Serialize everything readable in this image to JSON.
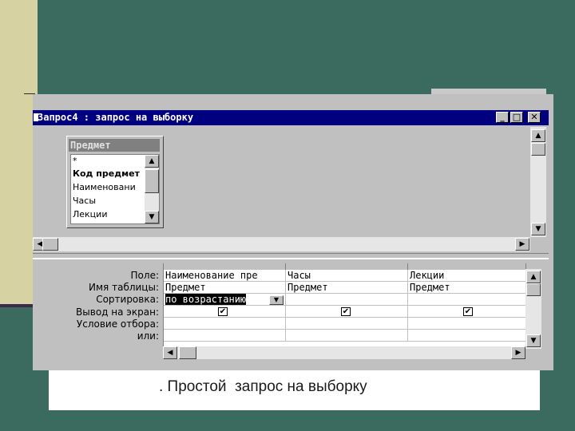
{
  "window": {
    "title": "Запрос4 : запрос на выборку",
    "minimize_glyph": "_",
    "maximize_glyph": "□",
    "close_glyph": "✕"
  },
  "field_list": {
    "title": "Предмет",
    "items": [
      "*",
      "Код предмет",
      "Наименовани",
      "Часы",
      "Лекции"
    ]
  },
  "grid": {
    "row_labels": [
      "Поле:",
      "Имя таблицы:",
      "Сортировка:",
      "Вывод на экран:",
      "Условие отбора:",
      "или:"
    ],
    "columns": [
      {
        "field": "Наименование пре",
        "table": "Предмет",
        "sort": "по возрастанию",
        "show": true
      },
      {
        "field": "Часы",
        "table": "Предмет",
        "sort": "",
        "show": true
      },
      {
        "field": "Лекции",
        "table": "Предмет",
        "sort": "",
        "show": true
      }
    ]
  },
  "icons": {
    "check": "✔",
    "arrow_up": "▲",
    "arrow_down": "▼",
    "arrow_left": "◀",
    "arrow_right": "▶"
  },
  "caption": ". Простой  запрос на выборку"
}
